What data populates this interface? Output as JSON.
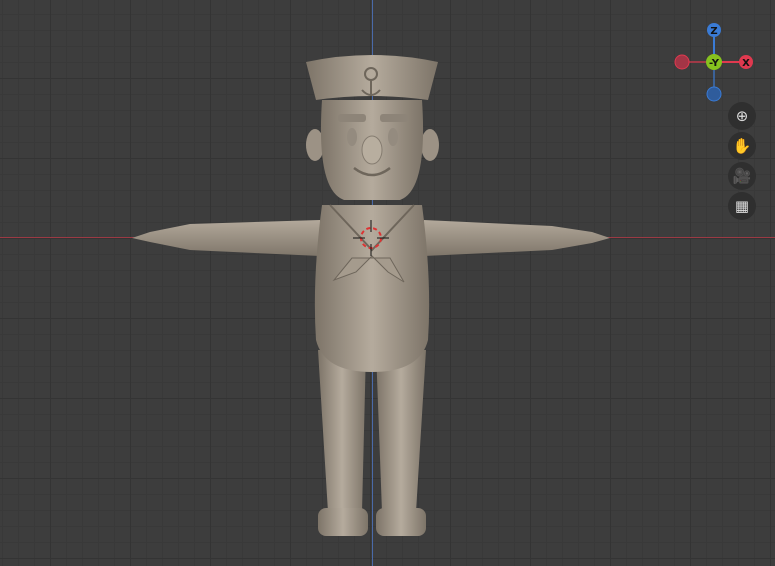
{
  "gizmo": {
    "z_label": "Z",
    "y_label": "-Y",
    "x_label": "X",
    "colors": {
      "x": "#e0394f",
      "y": "#86c21f",
      "z": "#3a7bd5"
    }
  },
  "nav_buttons": [
    {
      "name": "zoom",
      "icon": "zoom-in-icon"
    },
    {
      "name": "pan",
      "icon": "hand-icon"
    },
    {
      "name": "camera",
      "icon": "camera-icon"
    },
    {
      "name": "ortho-toggle",
      "icon": "grid-icon"
    }
  ]
}
